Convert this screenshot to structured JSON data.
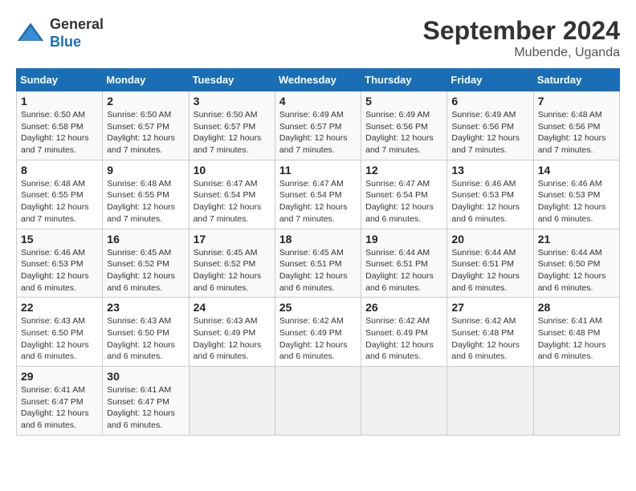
{
  "header": {
    "logo_general": "General",
    "logo_blue": "Blue",
    "month_title": "September 2024",
    "location": "Mubende, Uganda"
  },
  "columns": [
    "Sunday",
    "Monday",
    "Tuesday",
    "Wednesday",
    "Thursday",
    "Friday",
    "Saturday"
  ],
  "weeks": [
    [
      {
        "day": "1",
        "sunrise": "6:50 AM",
        "sunset": "6:58 PM",
        "daylight": "12 hours and 7 minutes."
      },
      {
        "day": "2",
        "sunrise": "6:50 AM",
        "sunset": "6:57 PM",
        "daylight": "12 hours and 7 minutes."
      },
      {
        "day": "3",
        "sunrise": "6:50 AM",
        "sunset": "6:57 PM",
        "daylight": "12 hours and 7 minutes."
      },
      {
        "day": "4",
        "sunrise": "6:49 AM",
        "sunset": "6:57 PM",
        "daylight": "12 hours and 7 minutes."
      },
      {
        "day": "5",
        "sunrise": "6:49 AM",
        "sunset": "6:56 PM",
        "daylight": "12 hours and 7 minutes."
      },
      {
        "day": "6",
        "sunrise": "6:49 AM",
        "sunset": "6:56 PM",
        "daylight": "12 hours and 7 minutes."
      },
      {
        "day": "7",
        "sunrise": "6:48 AM",
        "sunset": "6:56 PM",
        "daylight": "12 hours and 7 minutes."
      }
    ],
    [
      {
        "day": "8",
        "sunrise": "6:48 AM",
        "sunset": "6:55 PM",
        "daylight": "12 hours and 7 minutes."
      },
      {
        "day": "9",
        "sunrise": "6:48 AM",
        "sunset": "6:55 PM",
        "daylight": "12 hours and 7 minutes."
      },
      {
        "day": "10",
        "sunrise": "6:47 AM",
        "sunset": "6:54 PM",
        "daylight": "12 hours and 7 minutes."
      },
      {
        "day": "11",
        "sunrise": "6:47 AM",
        "sunset": "6:54 PM",
        "daylight": "12 hours and 7 minutes."
      },
      {
        "day": "12",
        "sunrise": "6:47 AM",
        "sunset": "6:54 PM",
        "daylight": "12 hours and 6 minutes."
      },
      {
        "day": "13",
        "sunrise": "6:46 AM",
        "sunset": "6:53 PM",
        "daylight": "12 hours and 6 minutes."
      },
      {
        "day": "14",
        "sunrise": "6:46 AM",
        "sunset": "6:53 PM",
        "daylight": "12 hours and 6 minutes."
      }
    ],
    [
      {
        "day": "15",
        "sunrise": "6:46 AM",
        "sunset": "6:53 PM",
        "daylight": "12 hours and 6 minutes."
      },
      {
        "day": "16",
        "sunrise": "6:45 AM",
        "sunset": "6:52 PM",
        "daylight": "12 hours and 6 minutes."
      },
      {
        "day": "17",
        "sunrise": "6:45 AM",
        "sunset": "6:52 PM",
        "daylight": "12 hours and 6 minutes."
      },
      {
        "day": "18",
        "sunrise": "6:45 AM",
        "sunset": "6:51 PM",
        "daylight": "12 hours and 6 minutes."
      },
      {
        "day": "19",
        "sunrise": "6:44 AM",
        "sunset": "6:51 PM",
        "daylight": "12 hours and 6 minutes."
      },
      {
        "day": "20",
        "sunrise": "6:44 AM",
        "sunset": "6:51 PM",
        "daylight": "12 hours and 6 minutes."
      },
      {
        "day": "21",
        "sunrise": "6:44 AM",
        "sunset": "6:50 PM",
        "daylight": "12 hours and 6 minutes."
      }
    ],
    [
      {
        "day": "22",
        "sunrise": "6:43 AM",
        "sunset": "6:50 PM",
        "daylight": "12 hours and 6 minutes."
      },
      {
        "day": "23",
        "sunrise": "6:43 AM",
        "sunset": "6:50 PM",
        "daylight": "12 hours and 6 minutes."
      },
      {
        "day": "24",
        "sunrise": "6:43 AM",
        "sunset": "6:49 PM",
        "daylight": "12 hours and 6 minutes."
      },
      {
        "day": "25",
        "sunrise": "6:42 AM",
        "sunset": "6:49 PM",
        "daylight": "12 hours and 6 minutes."
      },
      {
        "day": "26",
        "sunrise": "6:42 AM",
        "sunset": "6:49 PM",
        "daylight": "12 hours and 6 minutes."
      },
      {
        "day": "27",
        "sunrise": "6:42 AM",
        "sunset": "6:48 PM",
        "daylight": "12 hours and 6 minutes."
      },
      {
        "day": "28",
        "sunrise": "6:41 AM",
        "sunset": "6:48 PM",
        "daylight": "12 hours and 6 minutes."
      }
    ],
    [
      {
        "day": "29",
        "sunrise": "6:41 AM",
        "sunset": "6:47 PM",
        "daylight": "12 hours and 6 minutes."
      },
      {
        "day": "30",
        "sunrise": "6:41 AM",
        "sunset": "6:47 PM",
        "daylight": "12 hours and 6 minutes."
      },
      null,
      null,
      null,
      null,
      null
    ]
  ],
  "labels": {
    "sunrise": "Sunrise:",
    "sunset": "Sunset:",
    "daylight": "Daylight:"
  }
}
